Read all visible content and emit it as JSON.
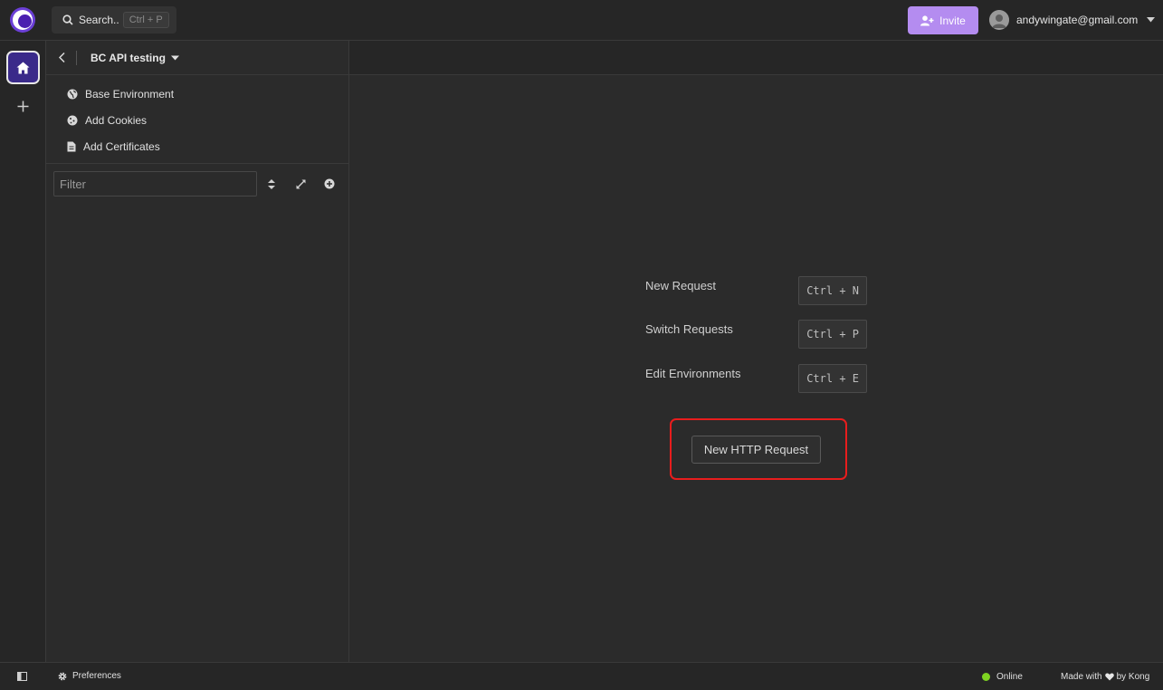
{
  "topbar": {
    "search_label": "Search..",
    "search_shortcut": "Ctrl + P",
    "invite_label": "Invite",
    "user_email": "andywingate@gmail.com"
  },
  "workspace": {
    "name": "BC API testing"
  },
  "sidebar": {
    "items": [
      {
        "label": "Base Environment",
        "icon": "globe-icon"
      },
      {
        "label": "Add Cookies",
        "icon": "cookie-icon"
      },
      {
        "label": "Add Certificates",
        "icon": "certificate-icon"
      }
    ],
    "filter_placeholder": "Filter"
  },
  "main": {
    "shortcuts": [
      {
        "label": "New Request",
        "keys": "Ctrl + N"
      },
      {
        "label": "Switch Requests",
        "keys": "Ctrl + P"
      },
      {
        "label": "Edit Environments",
        "keys": "Ctrl + E"
      }
    ],
    "new_http_request_label": "New HTTP Request"
  },
  "statusbar": {
    "preferences_label": "Preferences",
    "online_label": "Online",
    "made_with_prefix": "Made with",
    "made_with_suffix": "by Kong"
  },
  "colors": {
    "accent": "#6b3fd6",
    "invite_bg": "#b48cf0",
    "highlight_border": "#e81d1d",
    "online": "#7ed321"
  }
}
